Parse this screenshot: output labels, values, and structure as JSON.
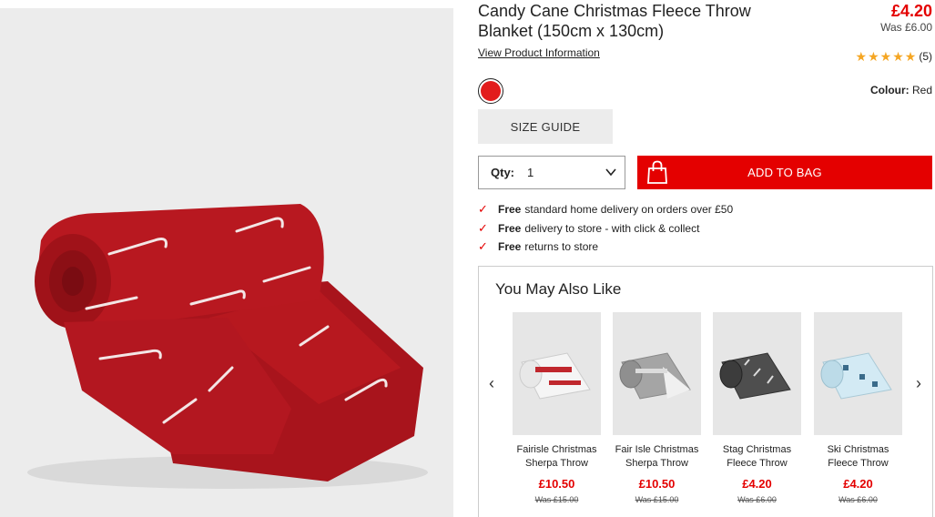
{
  "product": {
    "title": "Candy Cane Christmas Fleece Throw Blanket (150cm x 130cm)",
    "price": "£4.20",
    "was_price": "Was £6.00",
    "view_info_label": "View Product Information",
    "rating_stars": 5,
    "rating_count": "(5)",
    "colour_label": "Colour:",
    "colour_value": "Red",
    "swatch_color": "#e21c1c"
  },
  "actions": {
    "size_guide_label": "SIZE GUIDE",
    "qty_label": "Qty:",
    "qty_value": "1",
    "add_to_bag_label": "ADD TO BAG"
  },
  "benefits": [
    {
      "bold": "Free",
      "text": "standard home delivery on orders over £50"
    },
    {
      "bold": "Free",
      "text": "delivery to store - with click & collect"
    },
    {
      "bold": "Free",
      "text": "returns to store"
    }
  ],
  "recommendations": {
    "title": "You May Also Like",
    "items": [
      {
        "name_line1": "Fairisle Christmas",
        "name_line2": "Sherpa Throw",
        "price": "£10.50",
        "was": "Was £15.00",
        "color": "#f2f2f2"
      },
      {
        "name_line1": "Fair Isle Christmas",
        "name_line2": "Sherpa Throw",
        "price": "£10.50",
        "was": "Was £15.00",
        "color": "#9a9a9a"
      },
      {
        "name_line1": "Stag Christmas",
        "name_line2": "Fleece Throw",
        "price": "£4.20",
        "was": "Was £6.00",
        "color": "#4a4a4a"
      },
      {
        "name_line1": "Ski Christmas",
        "name_line2": "Fleece Throw",
        "price": "£4.20",
        "was": "Was £6.00",
        "color": "#cfe6f0"
      }
    ]
  },
  "colors": {
    "accent_red": "#e40000",
    "hero_background": "#ececec",
    "blanket_red": "#b81820"
  }
}
